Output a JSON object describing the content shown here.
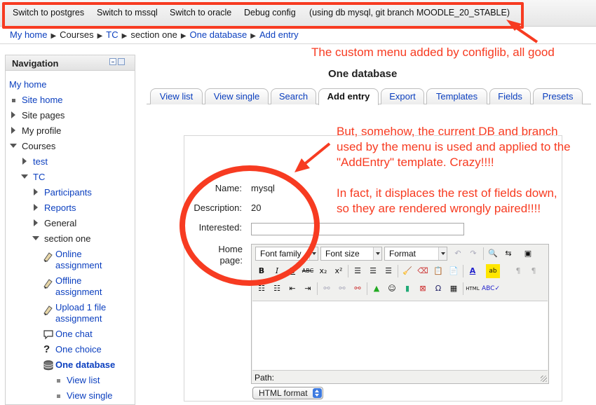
{
  "topmenu": {
    "items": [
      "Switch to postgres",
      "Switch to mssql",
      "Switch to oracle",
      "Debug config"
    ],
    "info": "(using db mysql, git branch MOODLE_20_STABLE)"
  },
  "breadcrumb": [
    "My home",
    "Courses",
    "TC",
    "section one",
    "One database",
    "Add entry"
  ],
  "navigation": {
    "title": "Navigation",
    "items": {
      "my_home": "My home",
      "site_home": "Site home",
      "site_pages": "Site pages",
      "my_profile": "My profile",
      "courses": "Courses",
      "test": "test",
      "tc": "TC",
      "participants": "Participants",
      "reports": "Reports",
      "general": "General",
      "section_one": "section one",
      "online_assignment": "Online assignment",
      "offline_assignment": "Offline assignment",
      "upload_assignment": "Upload 1 file assignment",
      "one_chat": "One chat",
      "one_choice": "One choice",
      "one_database": "One database",
      "view_list": "View list",
      "view_single": "View single"
    }
  },
  "main": {
    "title": "One database",
    "tabs": [
      "View list",
      "View single",
      "Search",
      "Add entry",
      "Export",
      "Templates",
      "Fields",
      "Presets"
    ],
    "active_tab": "Add entry",
    "form": {
      "name_label": "Name:",
      "name_value": "mysql",
      "description_label": "Description:",
      "description_value": "20",
      "interested_label": "Interested:",
      "homepage_label": "Home page:"
    },
    "editor": {
      "font_family": "Font family",
      "font_size": "Font size",
      "format": "Format",
      "path_label": "Path:",
      "format_select": "HTML format"
    }
  },
  "annotations": {
    "menu_note": "The custom menu added by configlib, all good",
    "note_lines": [
      "But, somehow, the current DB and branch",
      "used by the menu is used and applied to the",
      "\"AddEntry\" template. Crazy!!!!",
      "",
      "In fact, it displaces the rest of fields down,",
      "so they are rendered wrongly paired!!!!"
    ]
  },
  "colors": {
    "annotation_red": "#f73b21",
    "link_blue": "#0b3fbf"
  }
}
